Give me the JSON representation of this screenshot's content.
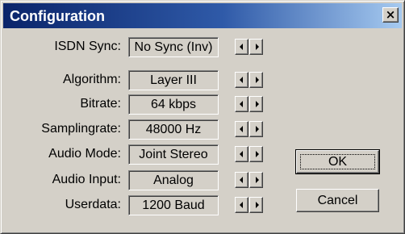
{
  "window": {
    "title": "Configuration",
    "close_glyph": "×"
  },
  "settings": [
    {
      "label": "ISDN Sync:",
      "value": "No Sync (Inv)"
    },
    {
      "label": "Algorithm:",
      "value": "Layer III"
    },
    {
      "label": "Bitrate:",
      "value": "64 kbps"
    },
    {
      "label": "Samplingrate:",
      "value": "48000 Hz"
    },
    {
      "label": "Audio Mode:",
      "value": "Joint Stereo"
    },
    {
      "label": "Audio Input:",
      "value": "Analog"
    },
    {
      "label": "Userdata:",
      "value": "1200 Baud"
    }
  ],
  "buttons": {
    "ok": "OK",
    "cancel": "Cancel"
  },
  "icons": {
    "arrow_left": "triangle-left-icon",
    "arrow_right": "triangle-right-icon",
    "close": "close-icon"
  },
  "colors": {
    "title_gradient_start": "#0a246a",
    "title_gradient_end": "#a6caf0",
    "face": "#d4d0c8"
  }
}
